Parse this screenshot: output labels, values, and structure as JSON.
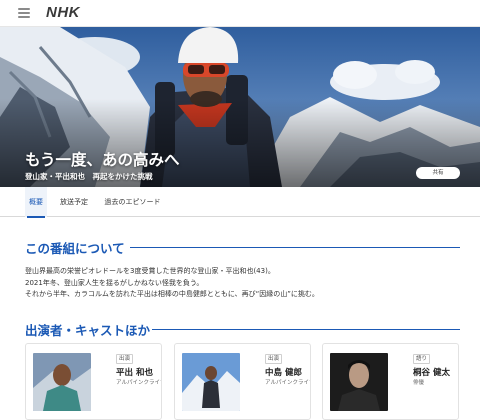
{
  "header": {
    "logo": "NHK"
  },
  "hero": {
    "title": "もう一度、あの高みへ",
    "subtitle": "登山家・平出和也　再起をかけた挑戦",
    "share_label": "共有"
  },
  "tabs": [
    {
      "label": "概要",
      "active": true
    },
    {
      "label": "放送予定",
      "active": false
    },
    {
      "label": "過去のエピソード",
      "active": false
    }
  ],
  "about": {
    "heading": "この番組について",
    "lines": [
      "登山界最高の栄誉ピオレドールを3度受賞した世界的な登山家・平出和也(43)。",
      "2021年冬、登山家人生を揺るがしかねない怪我を負う。",
      "それから半年、カラコルムを訪れた平出は相棒の中島健郎とともに、再び“因縁の山”に挑む。"
    ]
  },
  "cast": {
    "heading": "出演者・キャストほか",
    "members": [
      {
        "role": "出演",
        "name": "平出 和也",
        "job": "アルパインクライマー"
      },
      {
        "role": "出演",
        "name": "中島 健郎",
        "job": "アルパインクライマー"
      },
      {
        "role": "語り",
        "name": "桐谷 健太",
        "job": "俳優"
      }
    ]
  },
  "colors": {
    "accent": "#1b59b5"
  }
}
